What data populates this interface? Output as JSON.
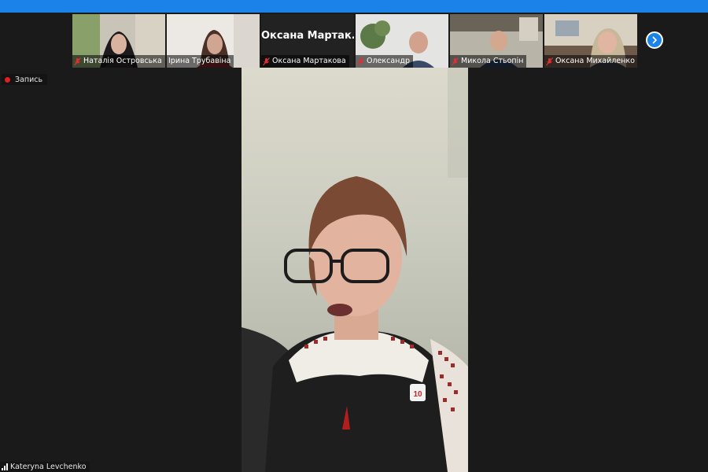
{
  "participants": [
    {
      "name": "Наталія Островська",
      "mic_muted": true
    },
    {
      "name": "Ірина  Трубавіна",
      "mic_muted": false
    },
    {
      "name": "Оксана Мартакова",
      "mic_muted": true,
      "display_name_large": "Оксана  Мартак..."
    },
    {
      "name": "Олександр",
      "mic_muted": true
    },
    {
      "name": "Микола Стьопін",
      "mic_muted": true
    },
    {
      "name": "Оксана Михайленко",
      "mic_muted": true
    }
  ],
  "recording": {
    "label": "Запись",
    "color": "#e02020"
  },
  "self_view": {
    "name": "Kateryna Levchenko"
  },
  "colors": {
    "accent": "#1a82e8",
    "background": "#1a1a1a"
  },
  "icons": {
    "next": "chevron-right-icon",
    "mic": "mic-muted-icon",
    "signal": "signal-icon"
  }
}
